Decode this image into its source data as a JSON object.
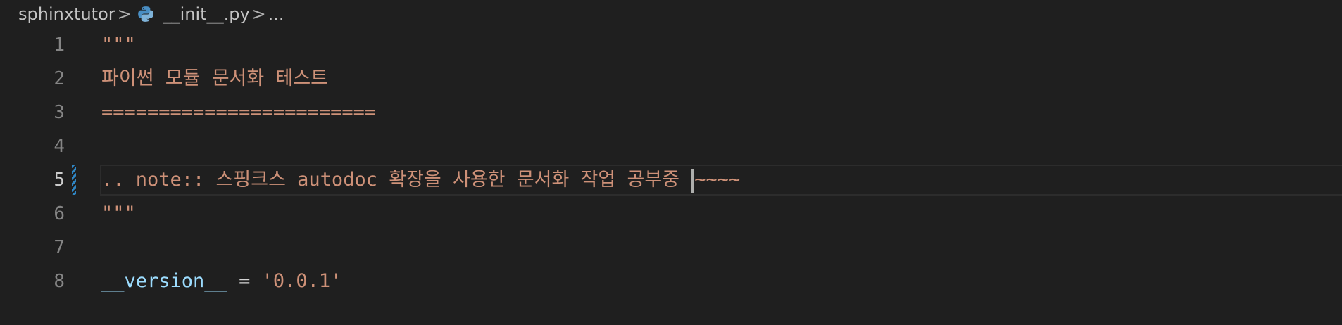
{
  "breadcrumb": {
    "folder": "sphinxtutor",
    "separator": ">",
    "file": "__init__.py",
    "more": "..."
  },
  "colors": {
    "background": "#1f1f1f",
    "string": "#ce9178",
    "variable": "#9cdcfe",
    "operator": "#d4d4d4",
    "line_number": "#858585",
    "active_line_number": "#cccccc",
    "modified_gutter": "#2f86c4"
  },
  "editor": {
    "active_line": 5,
    "lines": [
      {
        "number": "1",
        "text": "\"\"\""
      },
      {
        "number": "2",
        "text": "파이썬 모듈 문서화 테스트"
      },
      {
        "number": "3",
        "text": "========================"
      },
      {
        "number": "4",
        "text": ""
      },
      {
        "number": "5",
        "text_before_cursor": ".. note:: 스핑크스 autodoc 확장을 사용한 문서화 작업 공부중 ",
        "text_after_cursor": "~~~~"
      },
      {
        "number": "6",
        "text": "\"\"\""
      },
      {
        "number": "7",
        "text": ""
      },
      {
        "number": "8",
        "variable": "__version__",
        "operator": " = ",
        "string": "'0.0.1'"
      }
    ]
  }
}
